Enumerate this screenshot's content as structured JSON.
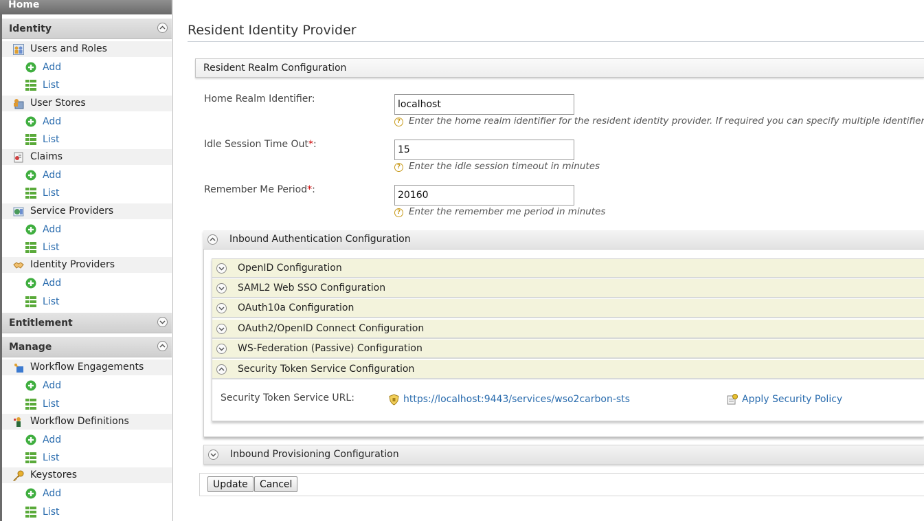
{
  "sidebar": {
    "home": "Home",
    "identity": {
      "title": "Identity",
      "groups": [
        {
          "label": "Users and Roles",
          "add": "Add",
          "list": "List"
        },
        {
          "label": "User Stores",
          "add": "Add",
          "list": "List"
        },
        {
          "label": "Claims",
          "add": "Add",
          "list": "List"
        },
        {
          "label": "Service Providers",
          "add": "Add",
          "list": "List"
        },
        {
          "label": "Identity Providers",
          "add": "Add",
          "list": "List"
        }
      ]
    },
    "entitlement": {
      "title": "Entitlement"
    },
    "manage": {
      "title": "Manage",
      "groups": [
        {
          "label": "Workflow Engagements",
          "add": "Add",
          "list": "List"
        },
        {
          "label": "Workflow Definitions",
          "add": "Add",
          "list": "List"
        },
        {
          "label": "Keystores",
          "add": "Add",
          "list": "List"
        }
      ]
    }
  },
  "main": {
    "title": "Resident Identity Provider",
    "realm_section": "Resident Realm Configuration",
    "home_realm": {
      "label": "Home Realm Identifier:",
      "value": "localhost",
      "help": "Enter the home realm identifier for the resident identity provider. If required you can specify multiple identifiers a"
    },
    "idle_timeout": {
      "label": "Idle Session Time Out",
      "value": "15",
      "help": "Enter the idle session timeout in minutes"
    },
    "remember_me": {
      "label": "Remember Me Period",
      "value": "20160",
      "help": "Enter the remember me period in minutes"
    },
    "required_mark": "*",
    "colon": ":",
    "inbound_auth": "Inbound Authentication Configuration",
    "sub_sections": [
      "OpenID Configuration",
      "SAML2 Web SSO Configuration",
      "OAuth10a Configuration",
      "OAuth2/OpenID Connect Configuration",
      "WS-Federation (Passive) Configuration",
      "Security Token Service Configuration"
    ],
    "sts": {
      "label": "Security Token Service URL:",
      "url": "https://localhost:9443/services/wso2carbon-sts",
      "apply_policy": "Apply Security Policy"
    },
    "inbound_prov": "Inbound Provisioning Configuration",
    "update_button": "Update",
    "cancel_button": "Cancel"
  }
}
